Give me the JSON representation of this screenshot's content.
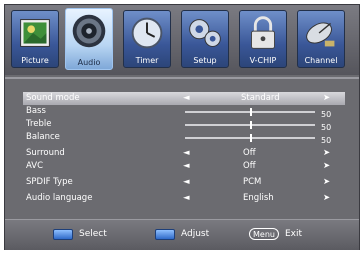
{
  "tabs": [
    {
      "label": "Picture",
      "icon": "picture-icon",
      "active": false
    },
    {
      "label": "Audio",
      "icon": "speaker-icon",
      "active": true
    },
    {
      "label": "Timer",
      "icon": "timer-icon",
      "active": false
    },
    {
      "label": "Setup",
      "icon": "gears-icon",
      "active": false
    },
    {
      "label": "V-CHIP",
      "icon": "lock-icon",
      "active": false
    },
    {
      "label": "Channel",
      "icon": "satellite-icon",
      "active": false
    }
  ],
  "menu": {
    "rows": [
      {
        "name": "Sound mode",
        "value": "Standard"
      },
      {
        "name": "Bass",
        "number": "50",
        "level": 0.5
      },
      {
        "name": "Treble",
        "number": "50",
        "level": 0.5
      },
      {
        "name": "Balance",
        "number": "50",
        "level": 0.5
      },
      {
        "name": "Surround",
        "value": "Off"
      },
      {
        "name": "AVC",
        "value": "Off"
      },
      {
        "name": "SPDIF Type",
        "value": "PCM"
      },
      {
        "name": "Audio language",
        "value": "English"
      }
    ],
    "left_arrow": "◄",
    "right_arrow": "➤"
  },
  "footer": {
    "select_label": "Select",
    "adjust_label": "Adjust",
    "menu_key": "Menu",
    "exit_label": "Exit"
  },
  "colors": {
    "accent": "#2f6ac9",
    "selected_row": "#bdbdc3"
  }
}
